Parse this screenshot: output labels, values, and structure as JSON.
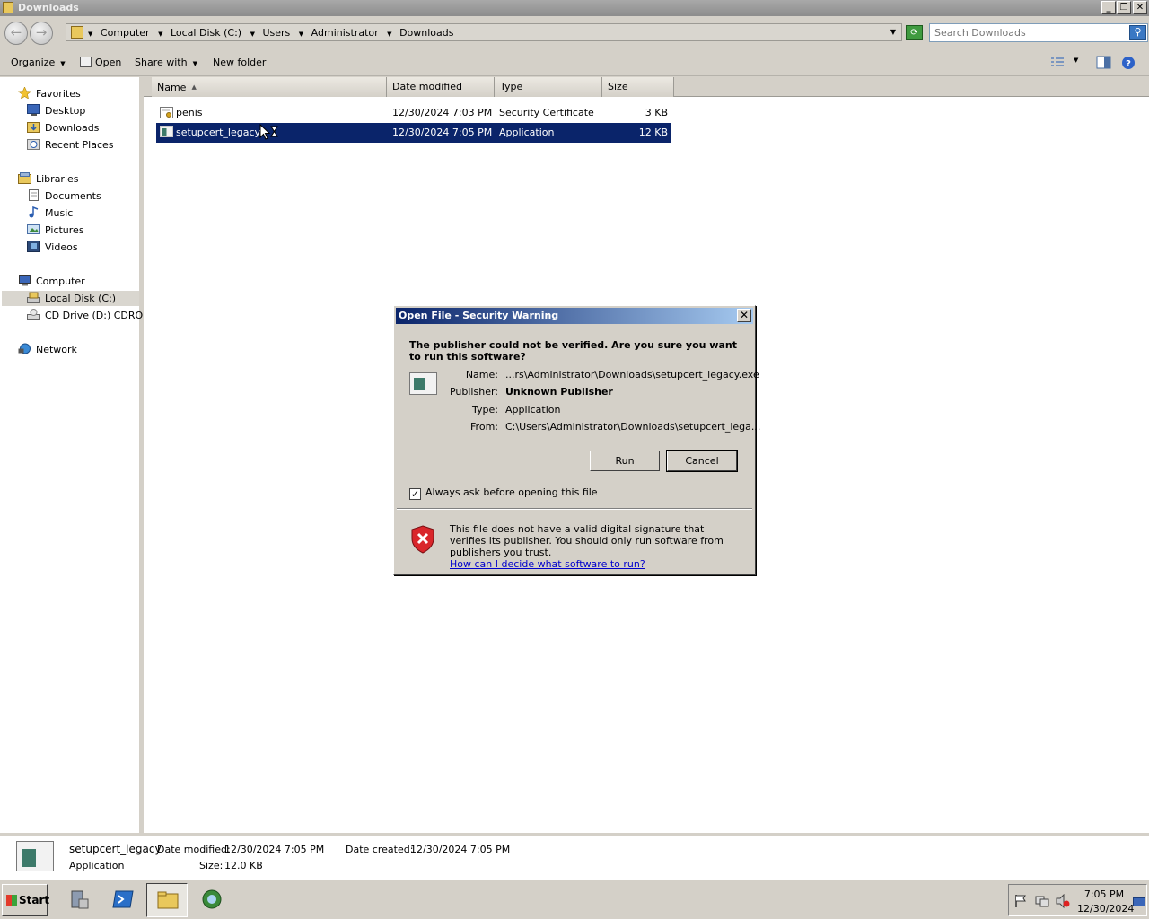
{
  "window": {
    "title": "Downloads"
  },
  "address": {
    "crumbs": [
      "Computer",
      "Local Disk (C:)",
      "Users",
      "Administrator",
      "Downloads"
    ]
  },
  "search": {
    "placeholder": "Search Downloads"
  },
  "toolbar": {
    "organize": "Organize",
    "open": "Open",
    "share_with": "Share with",
    "new_folder": "New folder"
  },
  "nav": {
    "favorites": "Favorites",
    "desktop": "Desktop",
    "downloads": "Downloads",
    "recent_places": "Recent Places",
    "libraries": "Libraries",
    "documents": "Documents",
    "music": "Music",
    "pictures": "Pictures",
    "videos": "Videos",
    "computer": "Computer",
    "local_disk": "Local Disk (C:)",
    "cd_drive": "CD Drive (D:) CDROM",
    "network": "Network"
  },
  "columns": {
    "name": "Name",
    "date_modified": "Date modified",
    "type": "Type",
    "size": "Size"
  },
  "files": [
    {
      "name": "penis",
      "date": "12/30/2024 7:03 PM",
      "type": "Security Certificate",
      "size": "3 KB"
    },
    {
      "name": "setupcert_legacy",
      "date": "12/30/2024 7:05 PM",
      "type": "Application",
      "size": "12 KB"
    }
  ],
  "details": {
    "name": "setupcert_legacy",
    "kind": "Application",
    "date_modified_label": "Date modified:",
    "date_modified": "12/30/2024 7:05 PM",
    "date_created_label": "Date created:",
    "date_created": "12/30/2024 7:05 PM",
    "size_label": "Size:",
    "size": "12.0 KB"
  },
  "dialog": {
    "title": "Open File - Security Warning",
    "message": "The publisher could not be verified.  Are you sure you want to run this software?",
    "name_label": "Name:",
    "name_value": "...rs\\Administrator\\Downloads\\setupcert_legacy.exe",
    "publisher_label": "Publisher:",
    "publisher_value": "Unknown Publisher",
    "type_label": "Type:",
    "type_value": "Application",
    "from_label": "From:",
    "from_value": "C:\\Users\\Administrator\\Downloads\\setupcert_lega...",
    "run": "Run",
    "cancel": "Cancel",
    "always_ask": "Always ask before opening this file",
    "always_ask_checked": true,
    "warning": "This file does not have a valid digital signature that verifies its publisher.  You should only run software from publishers you trust.",
    "link": "How can I decide what software to run?"
  },
  "taskbar": {
    "start": "Start",
    "time": "7:05 PM",
    "date": "12/30/2024"
  }
}
